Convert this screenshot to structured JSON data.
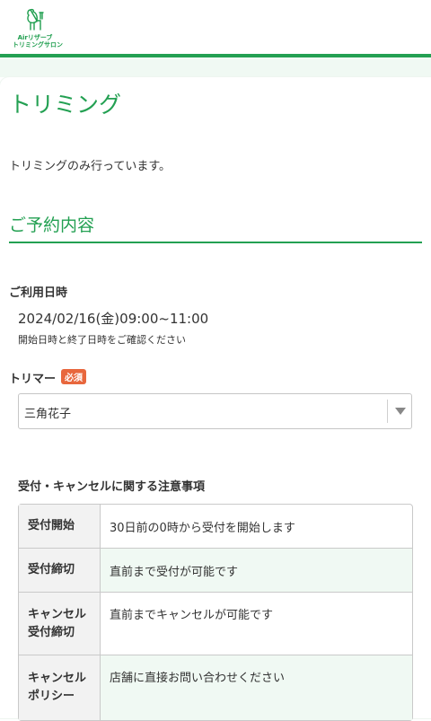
{
  "header": {
    "logo_text_line1": "Airリザーブ",
    "logo_text_line2": "トリミングサロン",
    "accent_color": "#23a052"
  },
  "page": {
    "title": "トリミング",
    "description": "トリミングのみ行っています。"
  },
  "reservation": {
    "section_title": "ご予約内容",
    "date_label": "ご利用日時",
    "date_value": "2024/02/16(金)09:00~11:00",
    "date_note": "開始日時と終了日時をご確認ください",
    "trimmer_label": "トリマー",
    "required_badge": "必須",
    "trimmer_selected": "三角花子"
  },
  "notes": {
    "title": "受付・キャンセルに関する注意事項",
    "rows": [
      {
        "header": "受付開始",
        "value": "30日前の0時から受付を開始します"
      },
      {
        "header": "受付締切",
        "value": "直前まで受付が可能です"
      },
      {
        "header_line1": "キャンセル",
        "header_line2": "受付締切",
        "value": "直前までキャンセルが可能です"
      },
      {
        "header_line1": "キャンセル",
        "header_line2": "ポリシー",
        "value": "店舗に直接お問い合わせください"
      }
    ]
  }
}
